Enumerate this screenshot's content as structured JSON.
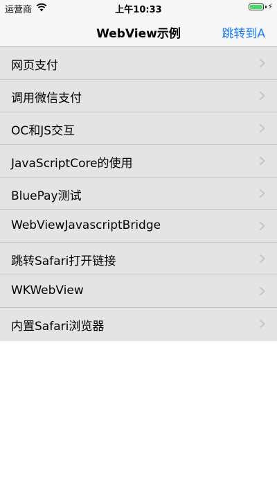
{
  "status_bar": {
    "carrier": "运营商",
    "time": "上午10:33",
    "battery_level": 1.0,
    "charging_symbol": "⚡"
  },
  "nav": {
    "title": "WebView示例",
    "right_button": "跳转到A"
  },
  "list": {
    "items": [
      {
        "label": "网页支付"
      },
      {
        "label": "调用微信支付"
      },
      {
        "label": "OC和JS交互"
      },
      {
        "label": "JavaScriptCore的使用"
      },
      {
        "label": "BluePay测试"
      },
      {
        "label": "WebViewJavascriptBridge"
      },
      {
        "label": "跳转Safari打开链接"
      },
      {
        "label": "WKWebView"
      },
      {
        "label": "内置Safari浏览器"
      }
    ]
  },
  "colors": {
    "accent": "#1a7cf5",
    "battery": "#4cd964",
    "row_background": "#e4e4e4"
  }
}
